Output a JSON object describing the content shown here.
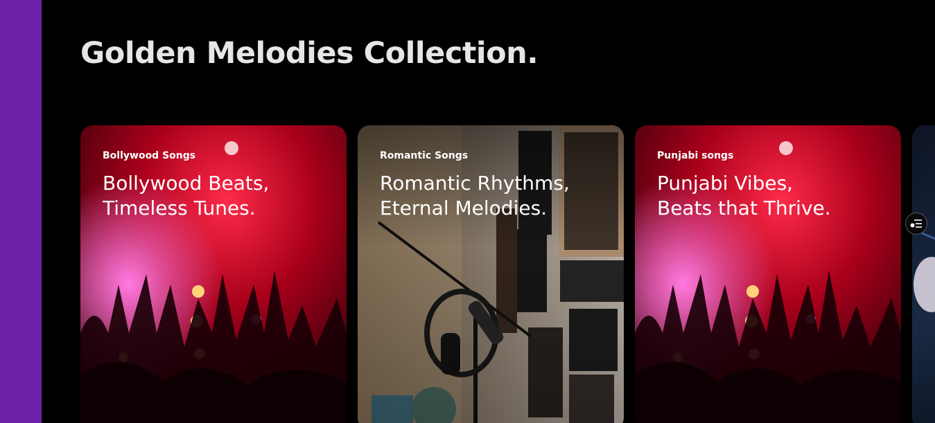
{
  "section": {
    "title": "Golden Melodies Collection."
  },
  "cards": [
    {
      "eyebrow": "Bollywood Songs",
      "heading_line1": "Bollywood Beats,",
      "heading_line2": "Timeless Tunes.",
      "image": "concert-crowd-red-lights"
    },
    {
      "eyebrow": "Romantic Songs",
      "heading_line1": "Romantic Rhythms,",
      "heading_line2": "Eternal Melodies.",
      "image": "studio-microphone-headphones-posters"
    },
    {
      "eyebrow": "Punjabi songs",
      "heading_line1": "Punjabi Vibes,",
      "heading_line2": "Beats that Thrive.",
      "image": "concert-crowd-red-lights"
    }
  ],
  "floating_button": {
    "icon": "playlist-menu-icon"
  },
  "colors": {
    "background": "#000000",
    "accent_strip": "#6b21a8",
    "title_text": "#e6e6e6",
    "card_text": "#ffffff"
  }
}
